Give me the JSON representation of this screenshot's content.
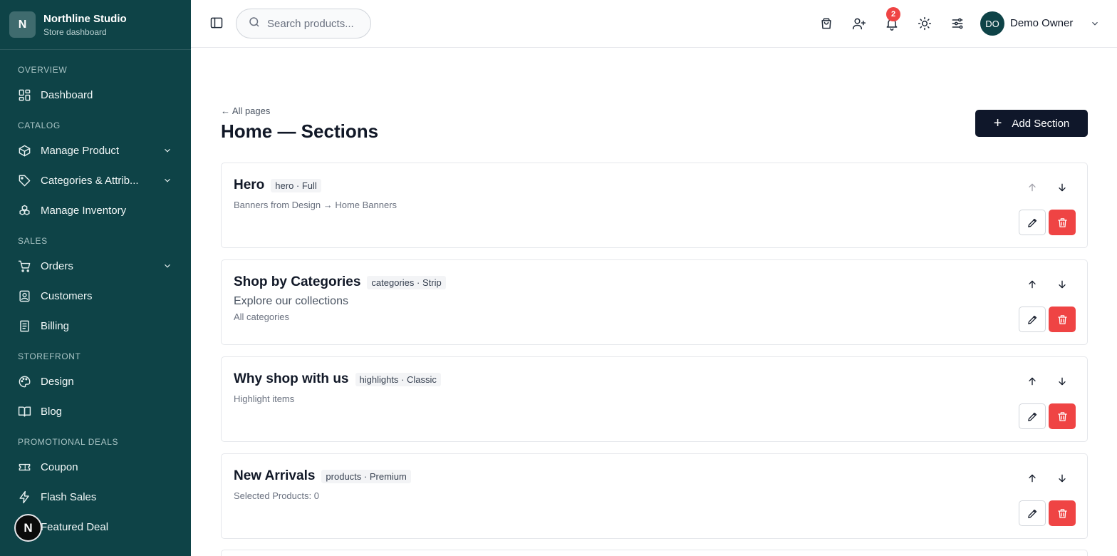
{
  "brand": {
    "initial": "N",
    "name": "Northline Studio",
    "subtitle": "Store dashboard"
  },
  "sidebar": {
    "sections": [
      {
        "label": "OVERVIEW",
        "items": [
          {
            "label": "Dashboard",
            "icon": "grid-icon"
          }
        ]
      },
      {
        "label": "CATALOG",
        "items": [
          {
            "label": "Manage Product",
            "icon": "box-icon",
            "expandable": true
          },
          {
            "label": "Categories & Attrib...",
            "icon": "tag-icon",
            "expandable": true
          },
          {
            "label": "Manage Inventory",
            "icon": "boxes-icon"
          }
        ]
      },
      {
        "label": "SALES",
        "items": [
          {
            "label": "Orders",
            "icon": "cart-icon",
            "expandable": true
          },
          {
            "label": "Customers",
            "icon": "contact-icon"
          },
          {
            "label": "Billing",
            "icon": "receipt-icon"
          }
        ]
      },
      {
        "label": "STOREFRONT",
        "items": [
          {
            "label": "Design",
            "icon": "palette-icon"
          },
          {
            "label": "Blog",
            "icon": "book-icon"
          }
        ]
      },
      {
        "label": "PROMOTIONAL DEALS",
        "items": [
          {
            "label": "Coupon",
            "icon": "ticket-icon"
          },
          {
            "label": "Flash Sales",
            "icon": "zap-icon"
          },
          {
            "label": "Featured Deal",
            "icon": "flame-icon"
          }
        ]
      }
    ],
    "floating_badge": "N"
  },
  "topbar": {
    "search_placeholder": "Search products...",
    "notification_count": "2",
    "user": {
      "initials": "DO",
      "name": "Demo Owner"
    }
  },
  "page": {
    "back_label": "← All pages",
    "title": "Home — Sections",
    "add_button_label": "Add Section"
  },
  "sections": [
    {
      "title": "Hero",
      "tag": "hero · Full",
      "subtitle": "",
      "meta": "Banners from Design → Home Banners",
      "up_disabled": true
    },
    {
      "title": "Shop by Categories",
      "tag": "categories · Strip",
      "subtitle": "Explore our collections",
      "meta": "All categories",
      "up_disabled": false
    },
    {
      "title": "Why shop with us",
      "tag": "highlights · Classic",
      "subtitle": "",
      "meta": "Highlight items",
      "up_disabled": false
    },
    {
      "title": "New Arrivals",
      "tag": "products · Premium",
      "subtitle": "",
      "meta": "Selected Products: 0",
      "up_disabled": false
    }
  ],
  "colors": {
    "sidebar_bg": "#0e4347",
    "primary_button": "#0f172a",
    "danger": "#ef4444"
  }
}
